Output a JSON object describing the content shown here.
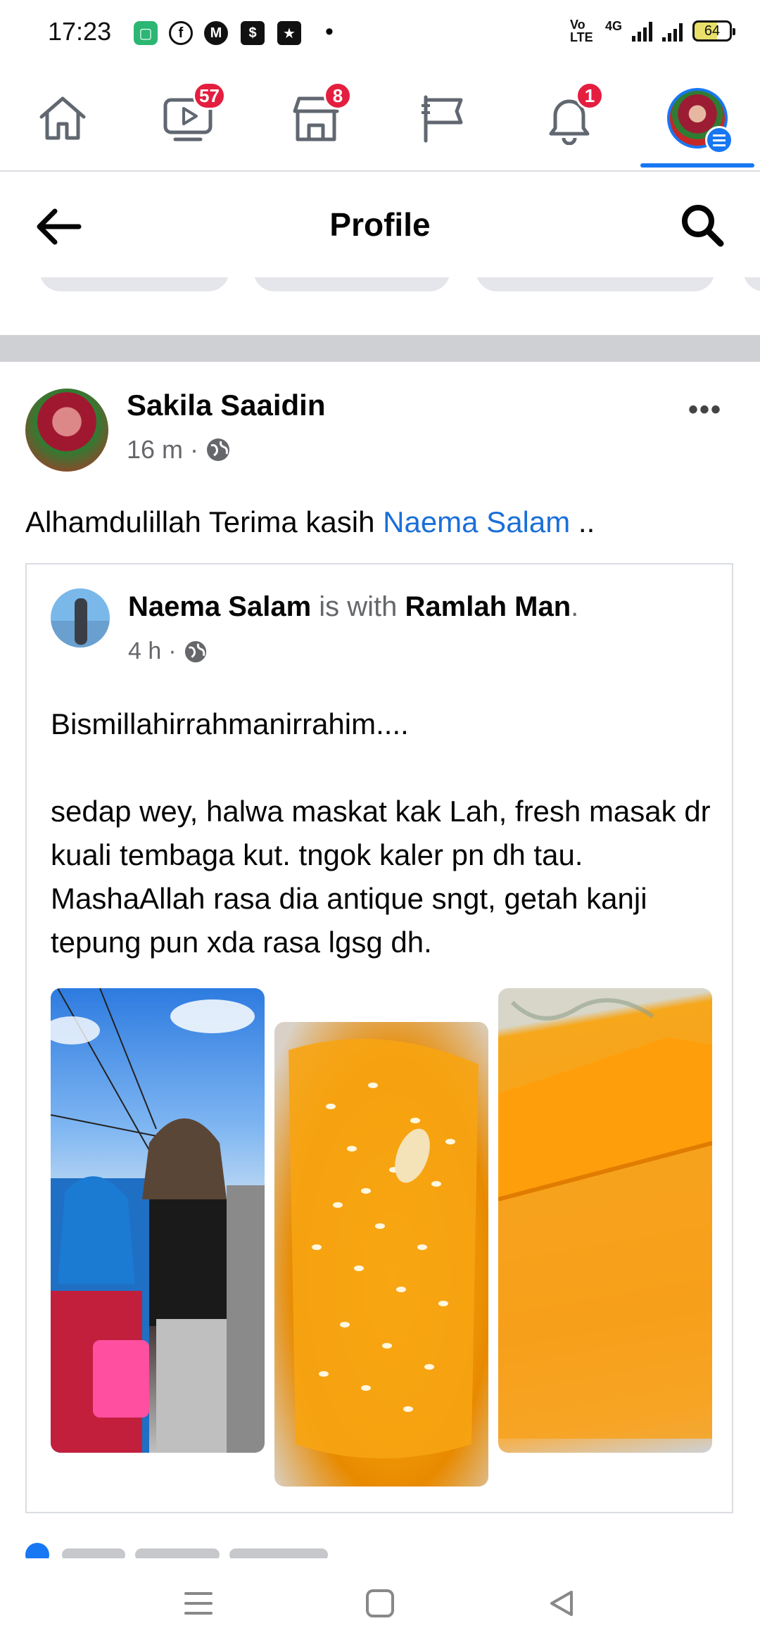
{
  "status_bar": {
    "time": "17:23",
    "network_label": "4G",
    "volte_label": "Vo LTE",
    "battery": "64",
    "dot": "•"
  },
  "nav": {
    "tabs": [
      {
        "name": "home",
        "icon": "home-icon"
      },
      {
        "name": "watch",
        "icon": "video-icon",
        "badge": "57"
      },
      {
        "name": "marketplace",
        "icon": "store-icon",
        "badge": "8"
      },
      {
        "name": "pages",
        "icon": "flag-icon"
      },
      {
        "name": "notifications",
        "icon": "bell-icon",
        "badge": "1"
      },
      {
        "name": "menu",
        "icon": "profile-avatar-icon"
      }
    ],
    "active_color": "#1877f2",
    "badge_color": "#e41e3f"
  },
  "header": {
    "title": "Profile"
  },
  "post": {
    "author": "Sakila Saaidin",
    "time": "16 m",
    "separator": "·",
    "more": "•••",
    "text_prefix": "Alhamdulillah Terima kasih ",
    "text_link": "Naema Salam",
    "text_suffix": " .."
  },
  "shared": {
    "author": "Naema Salam",
    "with_word": " is with ",
    "tagged": "Ramlah Man",
    "period": ".",
    "time": "4 h",
    "separator": "·",
    "text": "Bismillahirrahmanirrahim....\n\nsedap wey, halwa maskat kak Lah, fresh masak dr kuali tembaga kut. tngok kaler pn dh tau. MashaAllah rasa dia antique sngt, getah kanji tepung pun xda rasa lgsg dh."
  },
  "link_color": "#1b6fd8"
}
